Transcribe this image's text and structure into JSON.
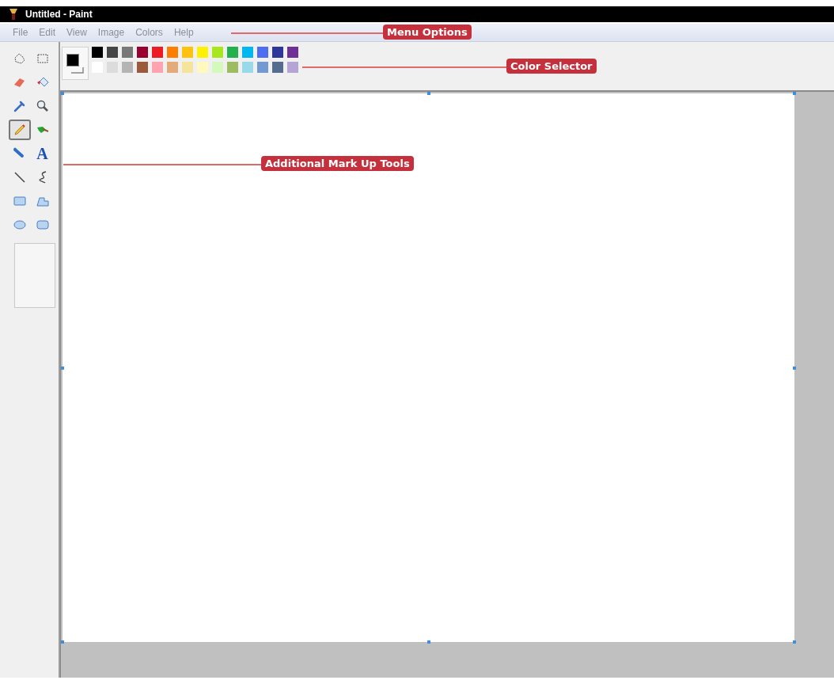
{
  "window": {
    "title": "Untitled - Paint"
  },
  "menu": [
    "File",
    "Edit",
    "View",
    "Image",
    "Colors",
    "Help"
  ],
  "tools": [
    {
      "kind": "free-select",
      "selected": false
    },
    {
      "kind": "rect-select",
      "selected": false
    },
    {
      "kind": "eraser",
      "selected": false
    },
    {
      "kind": "fill",
      "selected": false
    },
    {
      "kind": "picker",
      "selected": false
    },
    {
      "kind": "magnifier",
      "selected": false
    },
    {
      "kind": "pencil",
      "selected": true
    },
    {
      "kind": "brush",
      "selected": false
    },
    {
      "kind": "airbrush",
      "selected": false
    },
    {
      "kind": "text",
      "label": "A",
      "selected": false
    },
    {
      "kind": "line",
      "selected": false
    },
    {
      "kind": "curve",
      "selected": false
    },
    {
      "kind": "rectangle",
      "selected": false
    },
    {
      "kind": "polygon",
      "selected": false
    },
    {
      "kind": "ellipse",
      "selected": false
    },
    {
      "kind": "rounded-rect",
      "selected": false
    }
  ],
  "palette": [
    {
      "color": "#000000"
    },
    {
      "color": "#464646"
    },
    {
      "color": "#787878"
    },
    {
      "color": "#990030"
    },
    {
      "color": "#ed1c24"
    },
    {
      "color": "#ff7e00"
    },
    {
      "color": "#ffc20e"
    },
    {
      "color": "#fff200"
    },
    {
      "color": "#a8e61d"
    },
    {
      "color": "#22b14c"
    },
    {
      "color": "#00b7ef"
    },
    {
      "color": "#4d6df3"
    },
    {
      "color": "#2f3699"
    },
    {
      "color": "#6f3198"
    },
    {
      "color": "#ffffff"
    },
    {
      "color": "#dcdcdc"
    },
    {
      "color": "#b4b4b4"
    },
    {
      "color": "#9c5a3c"
    },
    {
      "color": "#ffa3b1"
    },
    {
      "color": "#e5aa7a"
    },
    {
      "color": "#f5e49c"
    },
    {
      "color": "#fff9bd"
    },
    {
      "color": "#d3f9bc"
    },
    {
      "color": "#9dbb61"
    },
    {
      "color": "#99d9ea"
    },
    {
      "color": "#709ad1"
    },
    {
      "color": "#546d8e"
    },
    {
      "color": "#b5a5d5"
    }
  ],
  "annotations": [
    {
      "label": "Menu Options"
    },
    {
      "label": "Color Selector"
    },
    {
      "label": "Additional Mark Up Tools"
    }
  ]
}
